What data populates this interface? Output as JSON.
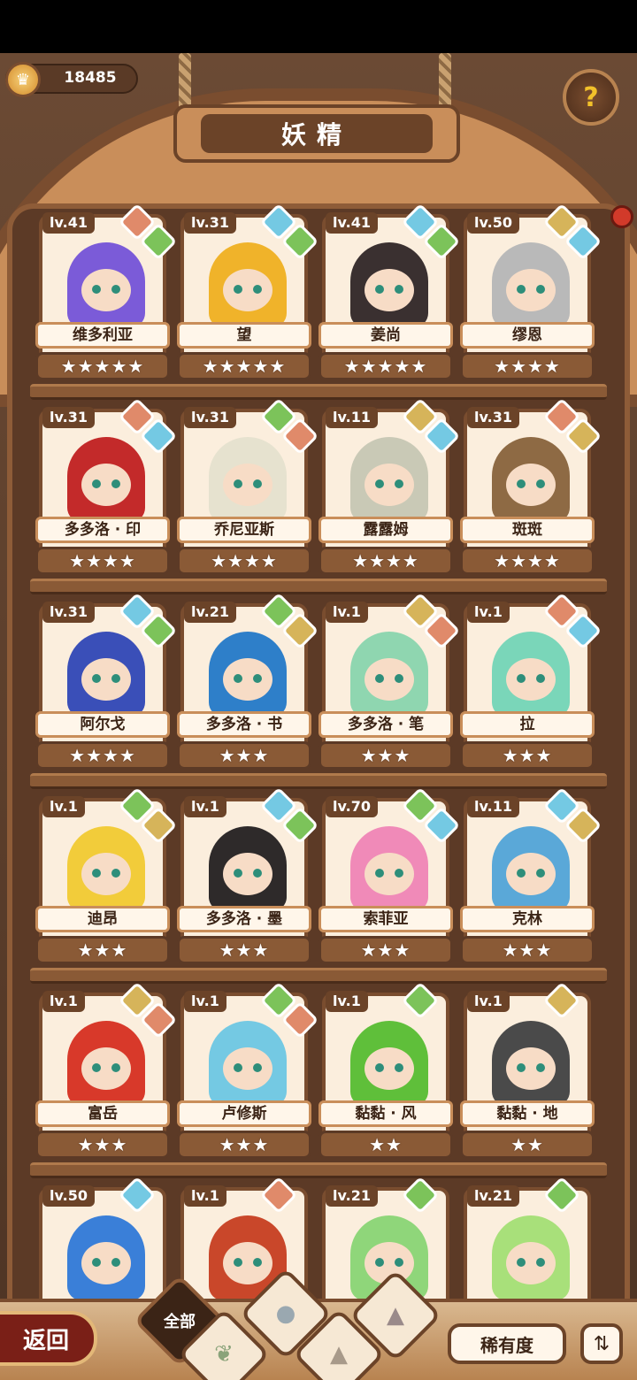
{
  "header": {
    "coins": "18485",
    "coin_icon": "crown-coin-icon",
    "title": "妖精",
    "help_icon": "question-sprout-icon"
  },
  "colors": {
    "fire": "#e08a6a",
    "water": "#74c9e3",
    "grass": "#7cc35a",
    "earth": "#d6b45a"
  },
  "fairies": [
    {
      "level": "lv.41",
      "name": "维多利亚",
      "stars": "★★★★★",
      "hair": "#7b5bd8",
      "gems": [
        "fire",
        "grass"
      ]
    },
    {
      "level": "lv.31",
      "name": "望",
      "stars": "★★★★★",
      "hair": "#f0b32a",
      "gems": [
        "water",
        "grass"
      ]
    },
    {
      "level": "lv.41",
      "name": "姜尚",
      "stars": "★★★★★",
      "hair": "#3a3030",
      "gems": [
        "water",
        "grass"
      ]
    },
    {
      "level": "lv.50",
      "name": "缪恩",
      "stars": "★★★★",
      "hair": "#b9b9b9",
      "gems": [
        "earth",
        "water"
      ]
    },
    {
      "level": "lv.31",
      "name": "多多洛 · 印",
      "stars": "★★★★",
      "hair": "#c32a2a",
      "gems": [
        "fire",
        "water"
      ]
    },
    {
      "level": "lv.31",
      "name": "乔尼亚斯",
      "stars": "★★★★",
      "hair": "#e6e2cf",
      "gems": [
        "grass",
        "fire"
      ]
    },
    {
      "level": "lv.11",
      "name": "露露姆",
      "stars": "★★★★",
      "hair": "#c9c9b6",
      "gems": [
        "earth",
        "water"
      ]
    },
    {
      "level": "lv.31",
      "name": "斑斑",
      "stars": "★★★★",
      "hair": "#8e6a44",
      "gems": [
        "fire",
        "earth"
      ]
    },
    {
      "level": "lv.31",
      "name": "阿尔戈",
      "stars": "★★★★",
      "hair": "#3a4fb8",
      "gems": [
        "water",
        "grass"
      ]
    },
    {
      "level": "lv.21",
      "name": "多多洛 · 书",
      "stars": "★★★",
      "hair": "#2e7fc9",
      "gems": [
        "grass",
        "earth"
      ]
    },
    {
      "level": "lv.1",
      "name": "多多洛 · 笔",
      "stars": "★★★",
      "hair": "#8fd6b0",
      "gems": [
        "earth",
        "fire"
      ]
    },
    {
      "level": "lv.1",
      "name": "拉",
      "stars": "★★★",
      "hair": "#7ad6b9",
      "gems": [
        "fire",
        "water"
      ]
    },
    {
      "level": "lv.1",
      "name": "迪昂",
      "stars": "★★★",
      "hair": "#f2cc3a",
      "gems": [
        "grass",
        "earth"
      ]
    },
    {
      "level": "lv.1",
      "name": "多多洛 · 墨",
      "stars": "★★★",
      "hair": "#2e2a2a",
      "gems": [
        "water",
        "grass"
      ]
    },
    {
      "level": "lv.70",
      "name": "索菲亚",
      "stars": "★★★",
      "hair": "#f08ab8",
      "gems": [
        "grass",
        "water"
      ]
    },
    {
      "level": "lv.11",
      "name": "克林",
      "stars": "★★★",
      "hair": "#5aa8d8",
      "gems": [
        "water",
        "earth"
      ]
    },
    {
      "level": "lv.1",
      "name": "富岳",
      "stars": "★★★",
      "hair": "#d8392a",
      "gems": [
        "earth",
        "fire"
      ]
    },
    {
      "level": "lv.1",
      "name": "卢修斯",
      "stars": "★★★",
      "hair": "#74c9e3",
      "gems": [
        "grass",
        "fire"
      ]
    },
    {
      "level": "lv.1",
      "name": "黏黏 · 风",
      "stars": "★★",
      "hair": "#5fbf3a",
      "gems": [
        "grass"
      ]
    },
    {
      "level": "lv.1",
      "name": "黏黏 · 地",
      "stars": "★★",
      "hair": "#4a4a4a",
      "gems": [
        "earth"
      ]
    },
    {
      "level": "lv.50",
      "name": "",
      "stars": "",
      "hair": "#3a7fd8",
      "gems": [
        "water"
      ]
    },
    {
      "level": "lv.1",
      "name": "",
      "stars": "",
      "hair": "#c9472a",
      "gems": [
        "fire"
      ]
    },
    {
      "level": "lv.21",
      "name": "",
      "stars": "",
      "hair": "#8fd67a",
      "gems": [
        "grass"
      ]
    },
    {
      "level": "lv.21",
      "name": "",
      "stars": "",
      "hair": "#a8e07a",
      "gems": [
        "grass"
      ]
    }
  ],
  "bottom": {
    "back_label": "返回",
    "filter_all_label": "全部",
    "rarity_label": "稀有度",
    "sort_icon": "sort-icon"
  }
}
